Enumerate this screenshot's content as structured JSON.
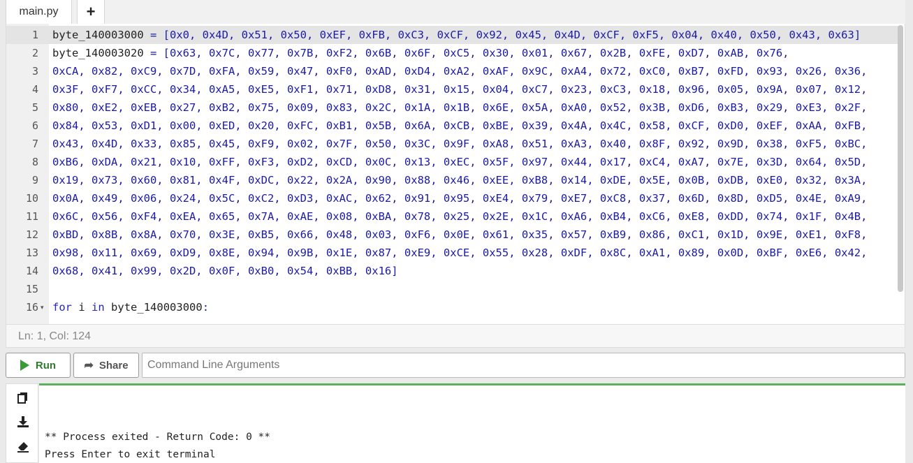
{
  "tabs": {
    "file_name": "main.py",
    "add_label": "+"
  },
  "editor": {
    "lines": [
      "byte_140003000 = [0x0, 0x4D, 0x51, 0x50, 0xEF, 0xFB, 0xC3, 0xCF, 0x92, 0x45, 0x4D, 0xCF, 0xF5, 0x04, 0x40, 0x50, 0x43, 0x63]",
      "byte_140003020 = [0x63, 0x7C, 0x77, 0x7B, 0xF2, 0x6B, 0x6F, 0xC5, 0x30, 0x01, 0x67, 0x2B, 0xFE, 0xD7, 0xAB, 0x76,",
      "0xCA, 0x82, 0xC9, 0x7D, 0xFA, 0x59, 0x47, 0xF0, 0xAD, 0xD4, 0xA2, 0xAF, 0x9C, 0xA4, 0x72, 0xC0, 0xB7, 0xFD, 0x93, 0x26, 0x36,",
      "0x3F, 0xF7, 0xCC, 0x34, 0xA5, 0xE5, 0xF1, 0x71, 0xD8, 0x31, 0x15, 0x04, 0xC7, 0x23, 0xC3, 0x18, 0x96, 0x05, 0x9A, 0x07, 0x12,",
      "0x80, 0xE2, 0xEB, 0x27, 0xB2, 0x75, 0x09, 0x83, 0x2C, 0x1A, 0x1B, 0x6E, 0x5A, 0xA0, 0x52, 0x3B, 0xD6, 0xB3, 0x29, 0xE3, 0x2F,",
      "0x84, 0x53, 0xD1, 0x00, 0xED, 0x20, 0xFC, 0xB1, 0x5B, 0x6A, 0xCB, 0xBE, 0x39, 0x4A, 0x4C, 0x58, 0xCF, 0xD0, 0xEF, 0xAA, 0xFB,",
      "0x43, 0x4D, 0x33, 0x85, 0x45, 0xF9, 0x02, 0x7F, 0x50, 0x3C, 0x9F, 0xA8, 0x51, 0xA3, 0x40, 0x8F, 0x92, 0x9D, 0x38, 0xF5, 0xBC,",
      "0xB6, 0xDA, 0x21, 0x10, 0xFF, 0xF3, 0xD2, 0xCD, 0x0C, 0x13, 0xEC, 0x5F, 0x97, 0x44, 0x17, 0xC4, 0xA7, 0x7E, 0x3D, 0x64, 0x5D,",
      "0x19, 0x73, 0x60, 0x81, 0x4F, 0xDC, 0x22, 0x2A, 0x90, 0x88, 0x46, 0xEE, 0xB8, 0x14, 0xDE, 0x5E, 0x0B, 0xDB, 0xE0, 0x32, 0x3A,",
      "0x0A, 0x49, 0x06, 0x24, 0x5C, 0xC2, 0xD3, 0xAC, 0x62, 0x91, 0x95, 0xE4, 0x79, 0xE7, 0xC8, 0x37, 0x6D, 0x8D, 0xD5, 0x4E, 0xA9,",
      "0x6C, 0x56, 0xF4, 0xEA, 0x65, 0x7A, 0xAE, 0x08, 0xBA, 0x78, 0x25, 0x2E, 0x1C, 0xA6, 0xB4, 0xC6, 0xE8, 0xDD, 0x74, 0x1F, 0x4B,",
      "0xBD, 0x8B, 0x8A, 0x70, 0x3E, 0xB5, 0x66, 0x48, 0x03, 0xF6, 0x0E, 0x61, 0x35, 0x57, 0xB9, 0x86, 0xC1, 0x1D, 0x9E, 0xE1, 0xF8,",
      "0x98, 0x11, 0x69, 0xD9, 0x8E, 0x94, 0x9B, 0x1E, 0x87, 0xE9, 0xCE, 0x55, 0x28, 0xDF, 0x8C, 0xA1, 0x89, 0x0D, 0xBF, 0xE6, 0x42,",
      "0x68, 0x41, 0x99, 0x2D, 0x0F, 0xB0, 0x54, 0xBB, 0x16]",
      "",
      "for i in byte_140003000:"
    ],
    "line_numbers": [
      "1",
      "2",
      "3",
      "4",
      "5",
      "6",
      "7",
      "8",
      "9",
      "10",
      "11",
      "12",
      "13",
      "14",
      "15",
      "16"
    ]
  },
  "status": {
    "cursor": "Ln: 1,  Col: 124"
  },
  "toolbar": {
    "run_label": "Run",
    "share_label": "Share",
    "args_placeholder": "Command Line Arguments"
  },
  "terminal": {
    "lines": [
      "** Process exited - Return Code: 0 **",
      "Press Enter to exit terminal"
    ]
  },
  "icons": {
    "copy": "copy-icon",
    "download": "download-icon",
    "erase": "eraser-icon"
  },
  "colors": {
    "run_green": "#3a9a3a",
    "terminal_border": "#5fae5f",
    "hex_literal": "#1a1aa6"
  }
}
